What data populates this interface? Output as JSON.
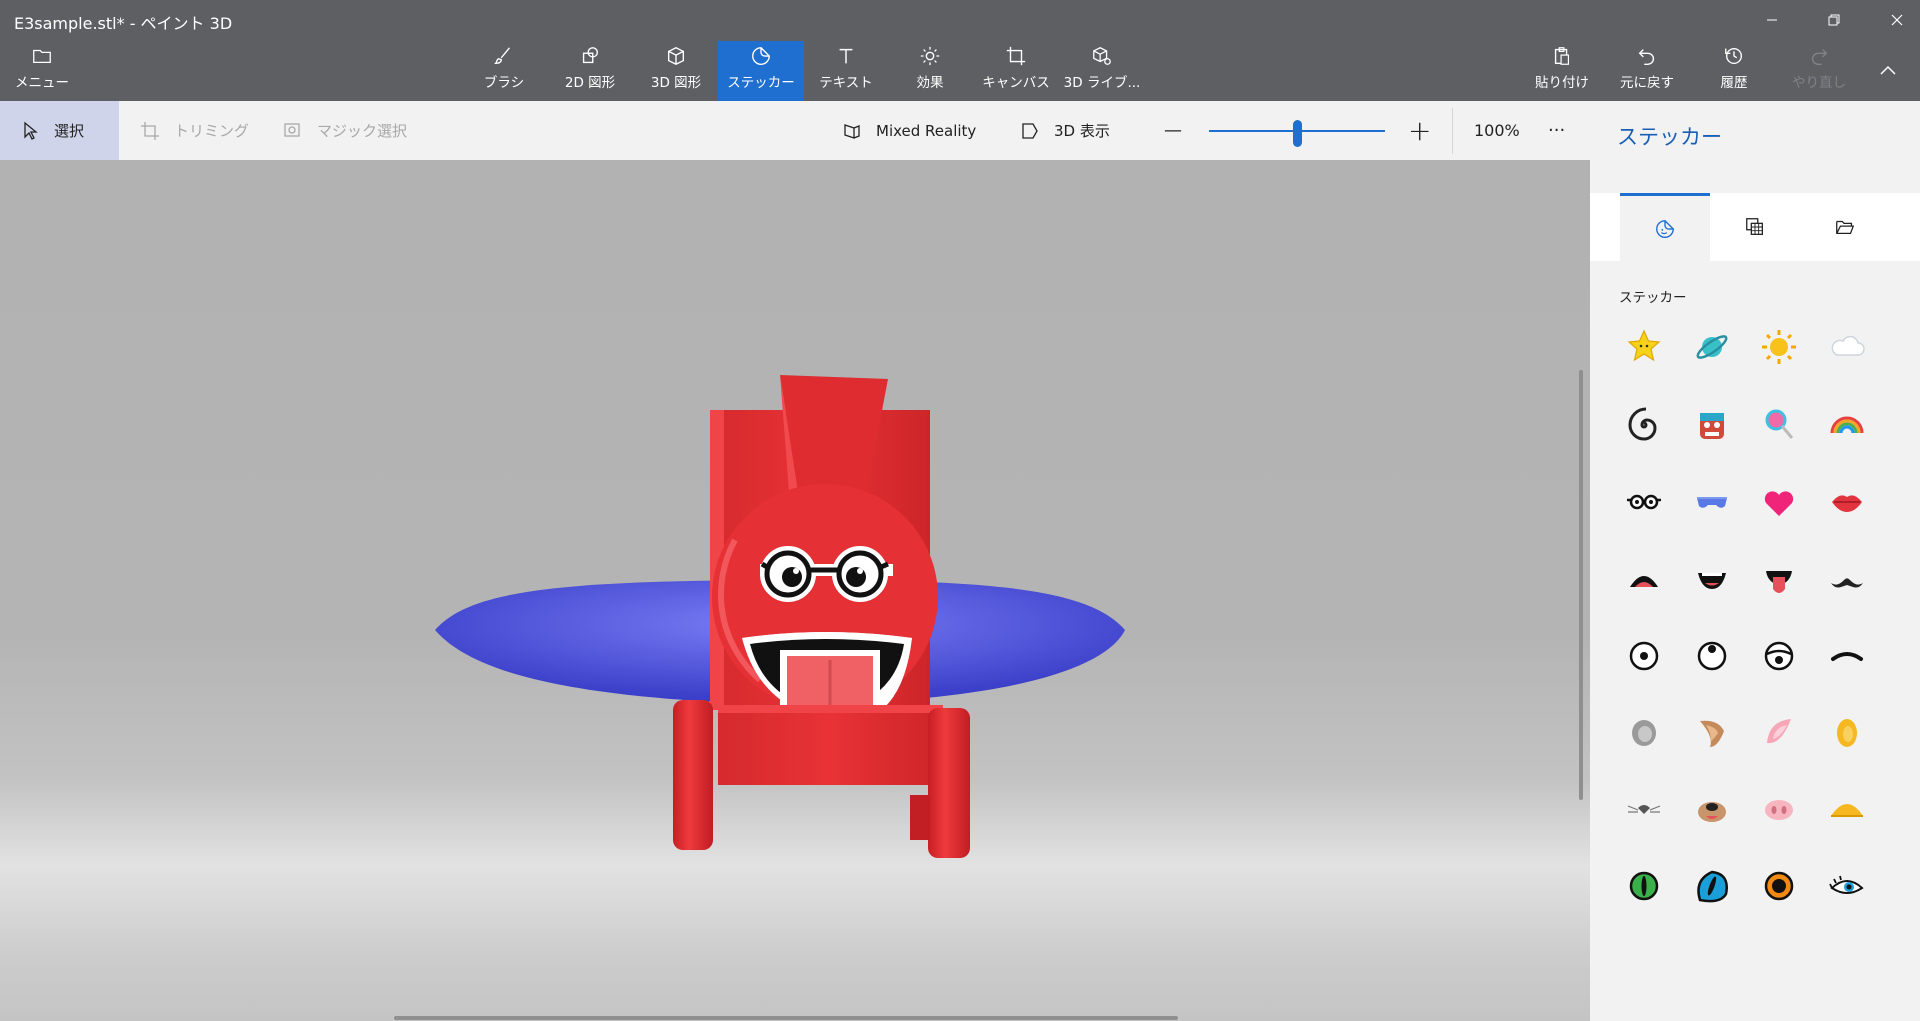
{
  "window": {
    "title": "E3sample.stl* - ペイント 3D",
    "minimize_icon": "minimize-icon",
    "maximize_icon": "restore-icon",
    "close_icon": "close-icon"
  },
  "ribbon": {
    "menu": {
      "label": "メニュー",
      "icon": "folder-icon"
    },
    "tools": [
      {
        "label": "ブラシ",
        "icon": "brush-icon"
      },
      {
        "label": "2D 図形",
        "icon": "shapes-2d-icon"
      },
      {
        "label": "3D 図形",
        "icon": "cube-icon"
      },
      {
        "label": "ステッカー",
        "icon": "sticker-icon",
        "active": true
      },
      {
        "label": "テキスト",
        "icon": "text-icon"
      },
      {
        "label": "効果",
        "icon": "sun-icon"
      },
      {
        "label": "キャンバス",
        "icon": "crop-canvas-icon"
      },
      {
        "label": "3D ライブ...",
        "icon": "library-3d-icon"
      }
    ],
    "actions": [
      {
        "label": "貼り付け",
        "icon": "paste-icon"
      },
      {
        "label": "元に戻す",
        "icon": "undo-icon"
      },
      {
        "label": "履歴",
        "icon": "history-icon"
      },
      {
        "label": "やり直し",
        "icon": "redo-icon",
        "disabled": true
      }
    ],
    "collapse_icon": "chevron-up-icon"
  },
  "commandbar": {
    "select": "選択",
    "crop": "トリミング",
    "magic_select": "マジック選択",
    "mixed_reality": "Mixed Reality",
    "view_3d": "3D 表示",
    "zoom_out": "—",
    "zoom_in": "+",
    "zoom_level": "100%",
    "zoom_fraction": 0.5,
    "more": "···"
  },
  "panel": {
    "title": "ステッカー",
    "tabs": [
      {
        "icon": "sticker-face-icon",
        "active": true
      },
      {
        "icon": "texture-icon"
      },
      {
        "icon": "open-folder-icon"
      }
    ],
    "section_label": "ステッカー",
    "stickers": [
      "star-sticker",
      "planet-sticker",
      "sun-sticker",
      "cloud-sticker",
      "spiral-sticker",
      "monster-sticker",
      "lollipop-sticker",
      "rainbow-sticker",
      "glasses-sticker",
      "sunglasses-sticker",
      "heart-sticker",
      "lips-sticker",
      "frown-mouth-sticker",
      "smile-mouth-sticker",
      "tongue-mouth-sticker",
      "mustache-sticker",
      "eye-center-sticker",
      "eye-up-sticker",
      "eye-sleepy-sticker",
      "eyebrow-sticker",
      "gray-ear-sticker",
      "dog-ear-sticker",
      "pink-ear-sticker",
      "yellow-ear-sticker",
      "mouse-nose-sticker",
      "dog-nose-sticker",
      "pig-nose-sticker",
      "beak-sticker",
      "green-cat-eye-sticker",
      "blue-cat-eye-sticker",
      "orange-eye-sticker",
      "lash-eye-sticker"
    ]
  },
  "colors": {
    "accent": "#1e6fd0",
    "ribbon_bg": "#5e5f63",
    "model_red": "#e53035",
    "model_blue": "#5a5de8"
  }
}
